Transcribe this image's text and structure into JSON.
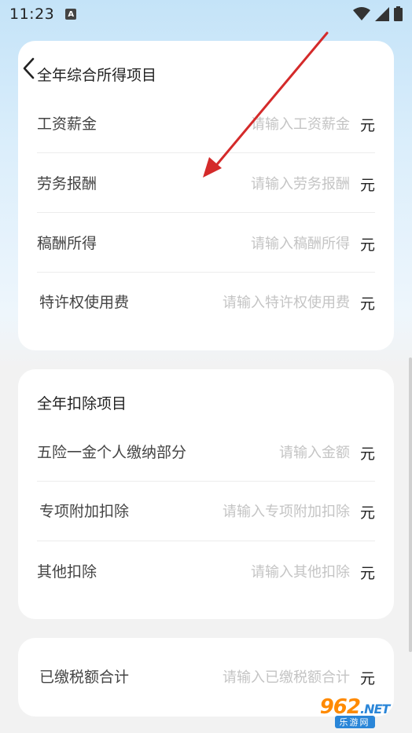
{
  "status_bar": {
    "time": "11:23",
    "notification_badge": "A"
  },
  "income_section": {
    "title": "全年综合所得项目",
    "unit": "元",
    "rows": [
      {
        "label": "工资薪金",
        "placeholder": "请输入工资薪金",
        "value": ""
      },
      {
        "label": "劳务报酬",
        "placeholder": "请输入劳务报酬",
        "value": ""
      },
      {
        "label": "稿酬所得",
        "placeholder": "请输入稿酬所得",
        "value": ""
      },
      {
        "label": "特许权使用费",
        "placeholder": "请输入特许权使用费",
        "value": ""
      }
    ]
  },
  "deduction_section": {
    "title": "全年扣除项目",
    "unit": "元",
    "rows": [
      {
        "label": "五险一金个人缴纳部分",
        "placeholder": "请输入金额",
        "value": ""
      },
      {
        "label": "专项附加扣除",
        "placeholder": "请输入专项附加扣除",
        "value": ""
      },
      {
        "label": "其他扣除",
        "placeholder": "请输入其他扣除",
        "value": ""
      }
    ]
  },
  "paid_section": {
    "unit": "元",
    "rows": [
      {
        "label": "已缴税额合计",
        "placeholder": "请输入已缴税额合计",
        "value": ""
      }
    ]
  },
  "watermark": {
    "main": "962",
    "suffix": ".NET",
    "sub": "乐游网"
  },
  "colors": {
    "accent_arrow": "#d42a2a",
    "card_bg": "#ffffff",
    "page_bg": "#f2f2f2"
  },
  "icons": [
    "back-chevron-icon",
    "wifi-icon",
    "signal-icon",
    "battery-icon"
  ]
}
